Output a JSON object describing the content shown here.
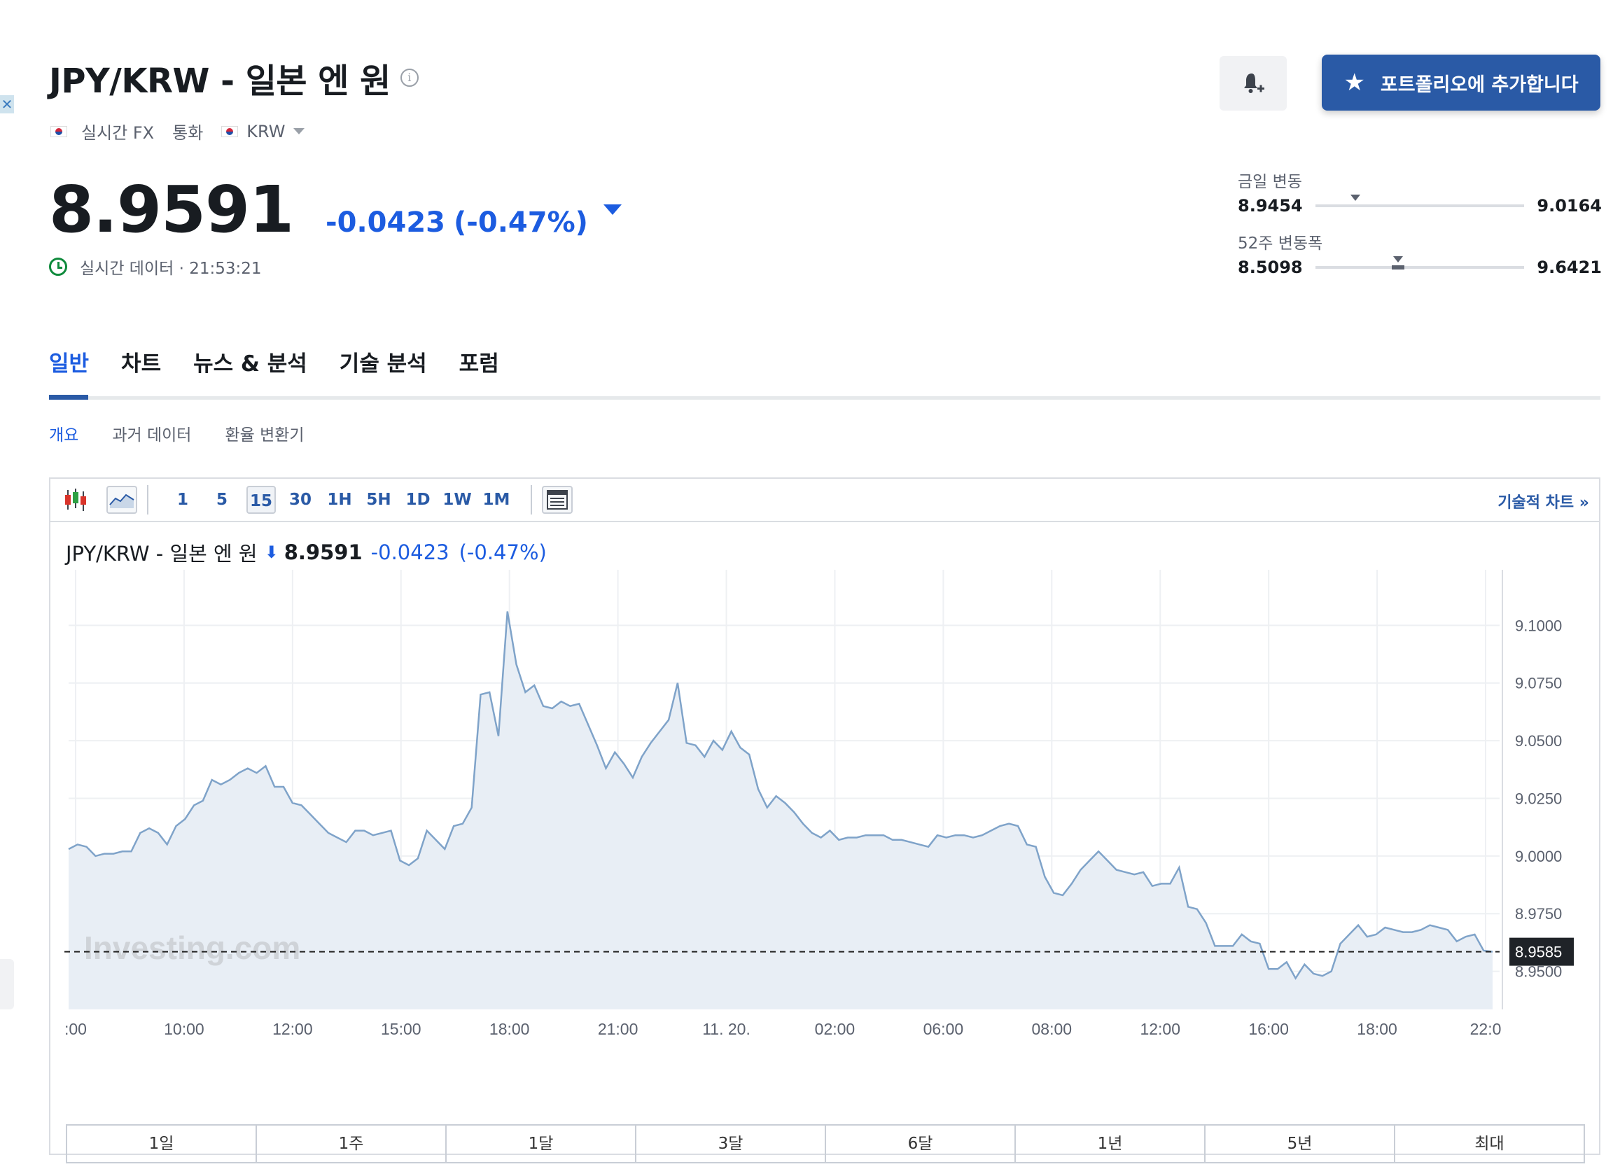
{
  "header": {
    "title": "JPY/KRW - 일본 엔 원",
    "meta": {
      "feed": "실시간 FX",
      "category": "통화",
      "currency": "KRW"
    },
    "price": "8.9591",
    "change": "-0.0423",
    "change_pct": "(-0.47%)",
    "realtime_label": "실시간 데이터 · 21:53:21",
    "portfolio_button": "포트폴리오에 추가합니다"
  },
  "ranges": {
    "day": {
      "label": "금일 변동",
      "low": "8.9454",
      "high": "9.0164",
      "current": 8.9591
    },
    "week52": {
      "label": "52주 변동폭",
      "low": "8.5098",
      "high": "9.6421",
      "current": 8.9591
    }
  },
  "tabs": [
    "일반",
    "차트",
    "뉴스 & 분석",
    "기술 분석",
    "포럼"
  ],
  "subtabs": [
    "개요",
    "과거 데이터",
    "환율 변환기"
  ],
  "toolbar": {
    "intervals": [
      "1",
      "5",
      "15",
      "30",
      "1H",
      "5H",
      "1D",
      "1W",
      "1M"
    ],
    "active_interval": "15",
    "tech_chart_link": "기술적 차트 »"
  },
  "legend": {
    "name": "JPY/KRW - 일본 엔 원",
    "price": "8.9591",
    "change": "-0.0423",
    "change_pct": "(-0.47%)"
  },
  "watermark": "Investing.com",
  "periods": [
    "1일",
    "1주",
    "1달",
    "3달",
    "6달",
    "1년",
    "5년",
    "최대"
  ],
  "chart_data": {
    "type": "area",
    "y_ticks": [
      "9.1000",
      "9.0750",
      "9.0500",
      "9.0250",
      "9.0000",
      "8.9750",
      "8.9500"
    ],
    "ylim": [
      8.9335,
      9.118
    ],
    "x_ticks": [
      ":00",
      "10:00",
      "12:00",
      "15:00",
      "18:00",
      "21:00",
      "11. 20.",
      "02:00",
      "06:00",
      "08:00",
      "12:00",
      "16:00",
      "18:00",
      "22:0"
    ],
    "current_label": "8.9585",
    "current_value": 8.9585,
    "colors": {
      "line": "#7fa3c9",
      "fill": "#e8eef5",
      "grid": "#eef0f3"
    },
    "values": [
      9.003,
      9.005,
      9.004,
      9.0,
      9.001,
      9.001,
      9.002,
      9.002,
      9.01,
      9.012,
      9.01,
      9.005,
      9.013,
      9.016,
      9.022,
      9.024,
      9.033,
      9.031,
      9.033,
      9.036,
      9.038,
      9.036,
      9.039,
      9.03,
      9.03,
      9.023,
      9.022,
      9.018,
      9.014,
      9.01,
      9.008,
      9.006,
      9.011,
      9.011,
      9.009,
      9.01,
      9.011,
      8.998,
      8.996,
      8.999,
      9.011,
      9.007,
      9.003,
      9.013,
      9.014,
      9.021,
      9.07,
      9.071,
      9.052,
      9.106,
      9.083,
      9.071,
      9.074,
      9.065,
      9.064,
      9.067,
      9.065,
      9.066,
      9.057,
      9.048,
      9.038,
      9.045,
      9.04,
      9.034,
      9.043,
      9.049,
      9.054,
      9.059,
      9.075,
      9.049,
      9.048,
      9.043,
      9.05,
      9.046,
      9.054,
      9.047,
      9.044,
      9.029,
      9.021,
      9.026,
      9.023,
      9.019,
      9.014,
      9.01,
      9.008,
      9.011,
      9.007,
      9.008,
      9.008,
      9.009,
      9.009,
      9.009,
      9.007,
      9.007,
      9.006,
      9.005,
      9.004,
      9.009,
      9.008,
      9.009,
      9.009,
      9.008,
      9.009,
      9.011,
      9.013,
      9.014,
      9.013,
      9.005,
      9.004,
      8.991,
      8.984,
      8.983,
      8.988,
      8.994,
      8.998,
      9.002,
      8.998,
      8.994,
      8.993,
      8.992,
      8.993,
      8.987,
      8.988,
      8.988,
      8.995,
      8.978,
      8.977,
      8.971,
      8.961,
      8.961,
      8.961,
      8.966,
      8.963,
      8.962,
      8.951,
      8.951,
      8.954,
      8.947,
      8.953,
      8.949,
      8.948,
      8.95,
      8.962,
      8.966,
      8.97,
      8.965,
      8.966,
      8.969,
      8.968,
      8.967,
      8.967,
      8.968,
      8.97,
      8.969,
      8.968,
      8.963,
      8.965,
      8.966,
      8.959,
      8.9585
    ]
  }
}
